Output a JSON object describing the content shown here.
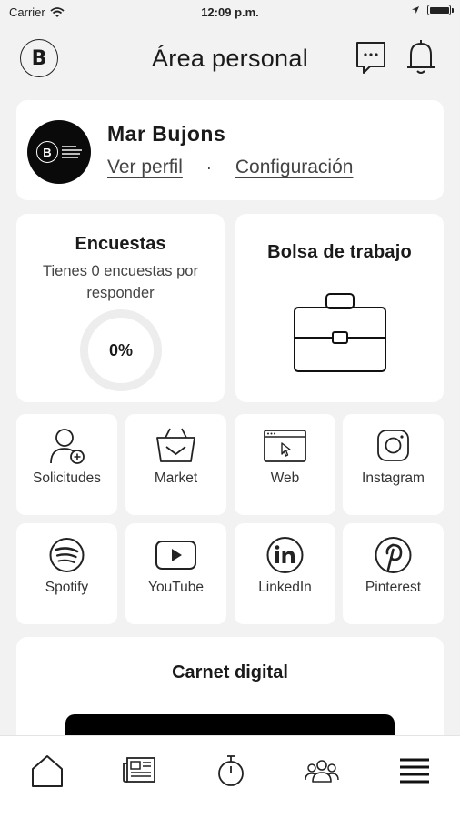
{
  "status_bar": {
    "carrier": "Carrier",
    "time": "12:09 p.m."
  },
  "header": {
    "logo_letter": "B",
    "title": "Área personal"
  },
  "profile": {
    "name": "Mar Bujons",
    "view_profile": "Ver perfil",
    "separator": "·",
    "settings": "Configuración"
  },
  "surveys": {
    "title": "Encuestas",
    "text": "Tienes 0 encuestas por responder",
    "percent": "0%"
  },
  "jobs": {
    "title": "Bolsa de trabajo"
  },
  "shortcuts": [
    {
      "label": "Solicitudes",
      "icon": "user-add-icon"
    },
    {
      "label": "Market",
      "icon": "basket-icon"
    },
    {
      "label": "Web",
      "icon": "browser-icon"
    },
    {
      "label": "Instagram",
      "icon": "instagram-icon"
    },
    {
      "label": "Spotify",
      "icon": "spotify-icon"
    },
    {
      "label": "YouTube",
      "icon": "youtube-icon"
    },
    {
      "label": "LinkedIn",
      "icon": "linkedin-icon"
    },
    {
      "label": "Pinterest",
      "icon": "pinterest-icon"
    }
  ],
  "carnet": {
    "title": "Carnet digital"
  },
  "tabbar": [
    "home-icon",
    "news-icon",
    "stopwatch-icon",
    "community-icon",
    "menu-icon"
  ]
}
